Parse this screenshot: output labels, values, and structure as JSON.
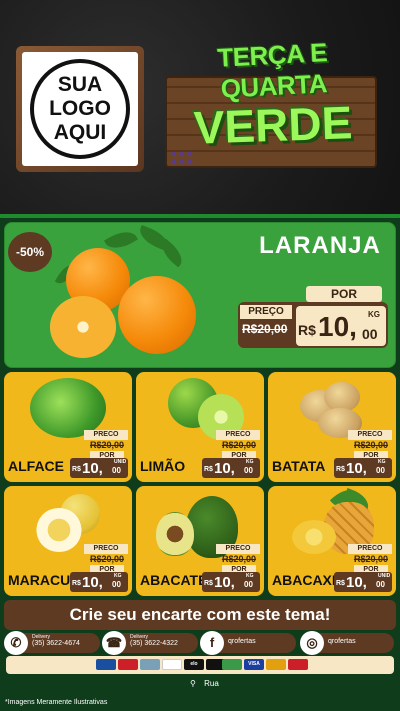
{
  "logo": {
    "line1": "SUA",
    "line2": "LOGO",
    "line3": "AQUI"
  },
  "title": {
    "line1": "TERÇA E QUARTA",
    "line2": "VERDE"
  },
  "featured": {
    "discount": "-50%",
    "name": "LARANJA",
    "por_label": "POR",
    "preco_label": "PREÇO",
    "old_price": "R$20,00",
    "currency": "R$",
    "price_int": "10,",
    "price_dec": "00",
    "unit": "KG"
  },
  "products": [
    {
      "name": "ALFACE",
      "preco_label": "PRECO",
      "old_price": "R$20,00",
      "por_label": "POR",
      "currency": "R$",
      "price_int": "10,",
      "price_dec": "00",
      "unit": "UNID"
    },
    {
      "name": "LIMÃO",
      "preco_label": "PRECO",
      "old_price": "R$20,00",
      "por_label": "POR",
      "currency": "R$",
      "price_int": "10,",
      "price_dec": "00",
      "unit": "KG"
    },
    {
      "name": "BATATA",
      "preco_label": "PRECO",
      "old_price": "R$20,00",
      "por_label": "POR",
      "currency": "R$",
      "price_int": "10,",
      "price_dec": "00",
      "unit": "KG"
    },
    {
      "name": "MARACUJÁ",
      "preco_label": "PRECO",
      "old_price": "R$20,00",
      "por_label": "POR",
      "currency": "R$",
      "price_int": "10,",
      "price_dec": "00",
      "unit": "KG"
    },
    {
      "name": "ABACATE",
      "preco_label": "PRECO",
      "old_price": "R$20,00",
      "por_label": "POR",
      "currency": "R$",
      "price_int": "10,",
      "price_dec": "00",
      "unit": "KG"
    },
    {
      "name": "ABACAXI",
      "preco_label": "PRECO",
      "old_price": "R$20,00",
      "por_label": "POR",
      "currency": "R$",
      "price_int": "10,",
      "price_dec": "00",
      "unit": "UNID"
    }
  ],
  "banner": "Crie seu encarte com este tema!",
  "contacts": {
    "whatsapp": {
      "label": "Delivery",
      "value": "(35) 3622-4674",
      "icon": "whatsapp-icon"
    },
    "phone": {
      "label": "Delivery",
      "value": "(35) 3622-4322",
      "icon": "phone-icon"
    },
    "facebook": {
      "value": "qrofertas",
      "icon": "facebook-icon"
    },
    "instagram": {
      "value": "qrofertas",
      "icon": "instagram-icon"
    }
  },
  "payments": [
    {
      "label": "",
      "color": "#1a4fa0"
    },
    {
      "label": "",
      "color": "#cc1f2a"
    },
    {
      "label": "",
      "color": "#7aa0b8"
    },
    {
      "label": "",
      "color": "#ffffff"
    },
    {
      "label": "elo",
      "color": "#111111"
    },
    {
      "label": "",
      "color": "#111111"
    },
    {
      "label": "",
      "color": "#3a9a4a"
    },
    {
      "label": "VISA",
      "color": "#1a3fa0"
    },
    {
      "label": "",
      "color": "#e2a010"
    },
    {
      "label": "",
      "color": "#cc1f2a"
    }
  ],
  "location": {
    "label": "Rua",
    "icon": "location-pin-icon"
  },
  "disclaimer": "*Imagens Meramente Ilustrativas",
  "colors": {
    "accent_green": "#39a23c",
    "card_yellow": "#f0b81a",
    "brown": "#5e3a22",
    "cream": "#f7e7c4"
  }
}
